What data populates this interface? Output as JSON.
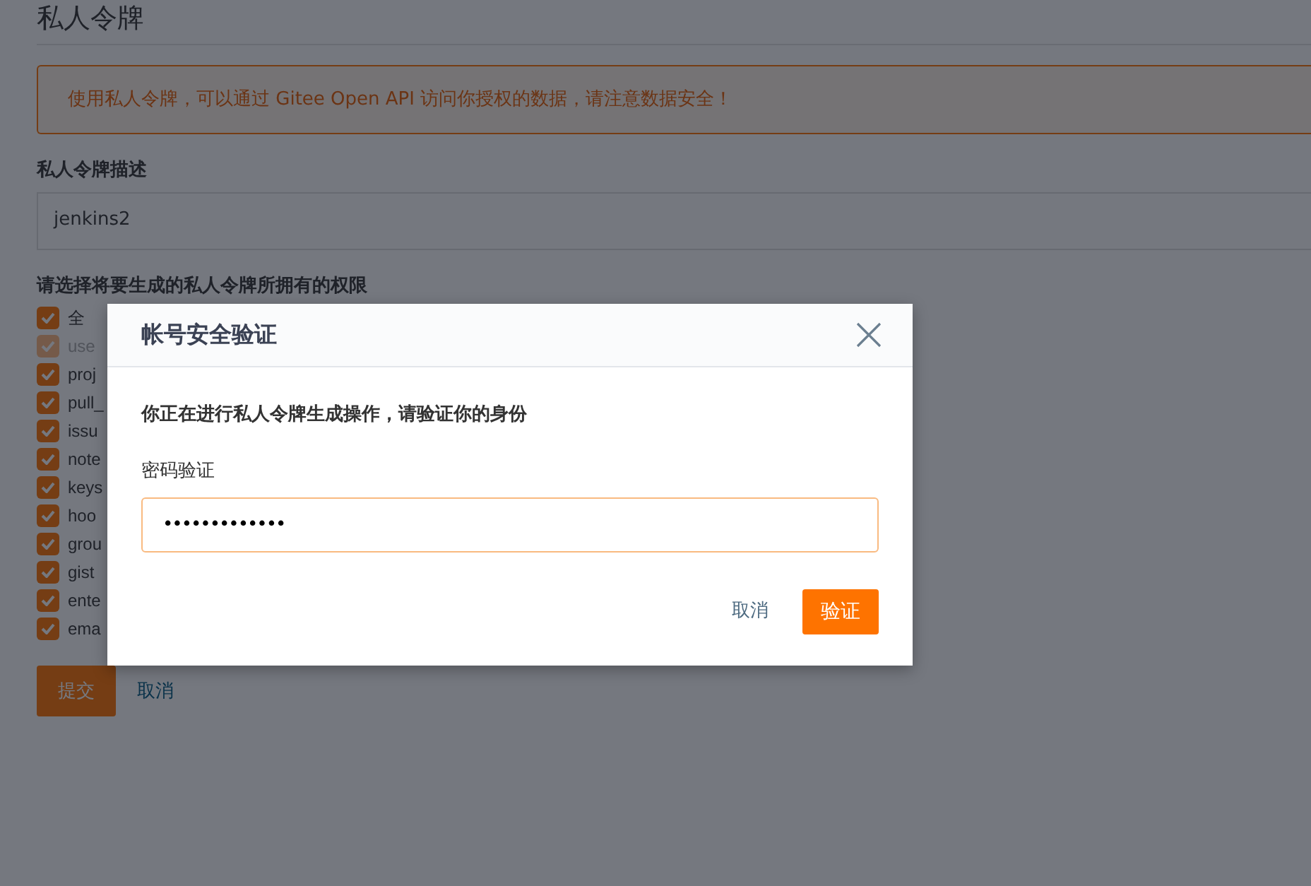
{
  "page": {
    "title": "私人令牌",
    "notice": "使用私人令牌，可以通过 Gitee Open API 访问你授权的数据，请注意数据安全！",
    "description_label": "私人令牌描述",
    "description_value": "jenkins2",
    "permissions_label": "请选择将要生成的私人令牌所拥有的权限",
    "permissions": [
      {
        "label": "全",
        "checked": true,
        "disabled": false
      },
      {
        "label": "use",
        "checked": true,
        "disabled": true
      },
      {
        "label": "proj",
        "checked": true,
        "disabled": false
      },
      {
        "label": "pull_",
        "checked": true,
        "disabled": false
      },
      {
        "label": "issu",
        "checked": true,
        "disabled": false
      },
      {
        "label": "note",
        "checked": true,
        "disabled": false
      },
      {
        "label": "keys",
        "checked": true,
        "disabled": false
      },
      {
        "label": "hoo",
        "checked": true,
        "disabled": false
      },
      {
        "label": "grou",
        "checked": true,
        "disabled": false
      },
      {
        "label": "gist",
        "checked": true,
        "disabled": false
      },
      {
        "label": "ente",
        "checked": true,
        "disabled": false
      },
      {
        "label": "ema",
        "checked": true,
        "disabled": false
      }
    ],
    "submit_button": "提交",
    "cancel_link": "取消"
  },
  "dialog": {
    "title": "帐号安全验证",
    "message": "你正在进行私人令牌生成操作，请验证你的身份",
    "password_label": "密码验证",
    "password_value": "•••••••••••••",
    "cancel_button": "取消",
    "confirm_button": "验证"
  }
}
